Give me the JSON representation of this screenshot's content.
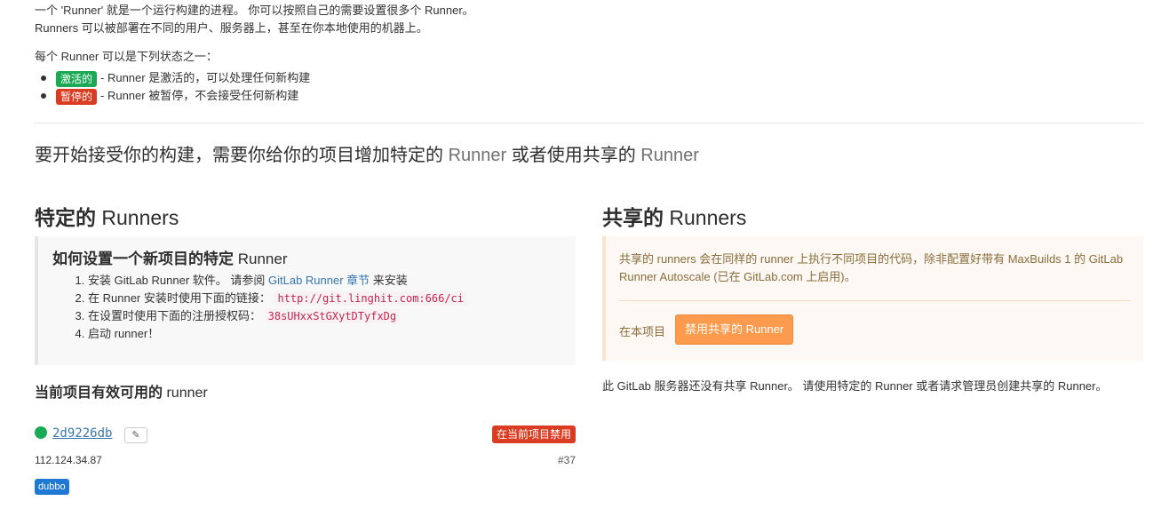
{
  "intro": {
    "line1": "一个 'Runner' 就是一个运行构建的进程。 你可以按照自己的需要设置很多个 Runner。",
    "line2": "Runners 可以被部署在不同的用户、服务器上，甚至在你本地使用的机器上。",
    "states_title": "每个 Runner 可以是下列状态之一：",
    "states": [
      {
        "badge": "激活的",
        "text": "- Runner 是激活的，可以处理任何新构建",
        "color": "#1aaa55"
      },
      {
        "badge": "暂停的",
        "text": "- Runner 被暂停，不会接受任何新构建",
        "color": "#db3b21"
      }
    ]
  },
  "lead": {
    "part1": "要开始接受你的构建，需要你给你的项目增加特定的 ",
    "runner1": "Runner",
    "part2": " 或者使用共享的 ",
    "runner2": "Runner"
  },
  "specific": {
    "title_bold": "特定的",
    "title_light": " Runners",
    "howto": {
      "title_bold": "如何设置一个新项目的特定",
      "title_light": " Runner",
      "step1_text": "安装 GitLab Runner 软件。 请参阅 ",
      "step1_link": "GitLab Runner 章节",
      "step1_after": " 来安装",
      "step2_text": "在 Runner 安装时使用下面的链接： ",
      "step2_code": "http://git.linghit.com:666/ci",
      "step3_text": "在设置时使用下面的注册授权码： ",
      "step3_code": "38sUHxxStGXytDTyfxDg",
      "step4_text": "启动 runner！"
    },
    "available_title_bold": "当前项目有效可用的",
    "available_title_light": " runner",
    "runner": {
      "token": "2d9226db",
      "disable_label": "在当前项目禁用",
      "ip": "112.124.34.87",
      "id": "#37",
      "tag": "dubbo"
    }
  },
  "shared": {
    "title_bold": "共享的",
    "title_light": " Runners",
    "description": "共享的 runners 会在同样的 runner 上执行不同项目的代码，除非配置好带有 MaxBuilds 1 的 GitLab Runner Autoscale (已在 GitLab.com 上启用)。",
    "scope_label": "在本项目",
    "disable_button": "禁用共享的 Runner",
    "note": "此 GitLab 服务器还没有共享 Runner。 请使用特定的 Runner 或者请求管理员创建共享的 Runner。"
  },
  "colors": {
    "link": "#3777b0",
    "active": "#1aaa55",
    "paused": "#db3b21",
    "warning_button": "#fc9a4d"
  }
}
